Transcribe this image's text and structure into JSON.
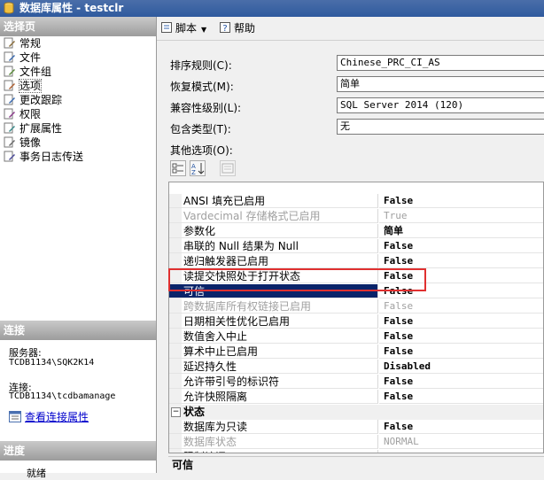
{
  "window": {
    "title": "数据库属性 - testclr"
  },
  "left": {
    "select_page_header": "选择页",
    "pages": [
      "常规",
      "文件",
      "文件组",
      "选项",
      "更改跟踪",
      "权限",
      "扩展属性",
      "镜像",
      "事务日志传送"
    ],
    "selected_page_index": 3,
    "connection_header": "连接",
    "server_label": "服务器:",
    "server_value": "TCDB1134\\SQK2K14",
    "connection_label": "连接:",
    "connection_value": "TCDB1134\\tcdbamanage",
    "view_connection_link": "查看连接属性",
    "progress_header": "进度",
    "progress_status": "就绪"
  },
  "toolbar": {
    "script_label": "脚本",
    "help_label": "帮助"
  },
  "form": {
    "collation_label": "排序规则(C):",
    "collation_value": "Chinese_PRC_CI_AS",
    "recovery_label": "恢复模式(M):",
    "recovery_value": "简单",
    "compat_label": "兼容性级别(L):",
    "compat_value": "SQL Server 2014 (120)",
    "containment_label": "包含类型(T):",
    "containment_value": "无",
    "other_options_label": "其他选项(O):"
  },
  "grid": {
    "rows": [
      {
        "name": "ANSI 填充已启用",
        "value": "False"
      },
      {
        "name": "Vardecimal 存储格式已启用",
        "value": "True",
        "disabled": true
      },
      {
        "name": "参数化",
        "value": "简单"
      },
      {
        "name": "串联的 Null 结果为 Null",
        "value": "False"
      },
      {
        "name": "递归触发器已启用",
        "value": "False"
      },
      {
        "name": "读提交快照处于打开状态",
        "value": "False"
      },
      {
        "name": "可信",
        "value": "False",
        "selected": true
      },
      {
        "name": "跨数据库所有权链接已启用",
        "value": "False",
        "disabled": true
      },
      {
        "name": "日期相关性优化已启用",
        "value": "False"
      },
      {
        "name": "数值舍入中止",
        "value": "False"
      },
      {
        "name": "算术中止已启用",
        "value": "False"
      },
      {
        "name": "延迟持久性",
        "value": "Disabled"
      },
      {
        "name": "允许带引号的标识符",
        "value": "False"
      },
      {
        "name": "允许快照隔离",
        "value": "False"
      }
    ],
    "state_category": "状态",
    "state_rows": [
      {
        "name": "数据库为只读",
        "value": "False"
      },
      {
        "name": "数据库状态",
        "value": "NORMAL",
        "disabled": true
      },
      {
        "name": "限制访问",
        "value": "MULTI_USER"
      }
    ]
  },
  "description": {
    "title": "可信"
  }
}
